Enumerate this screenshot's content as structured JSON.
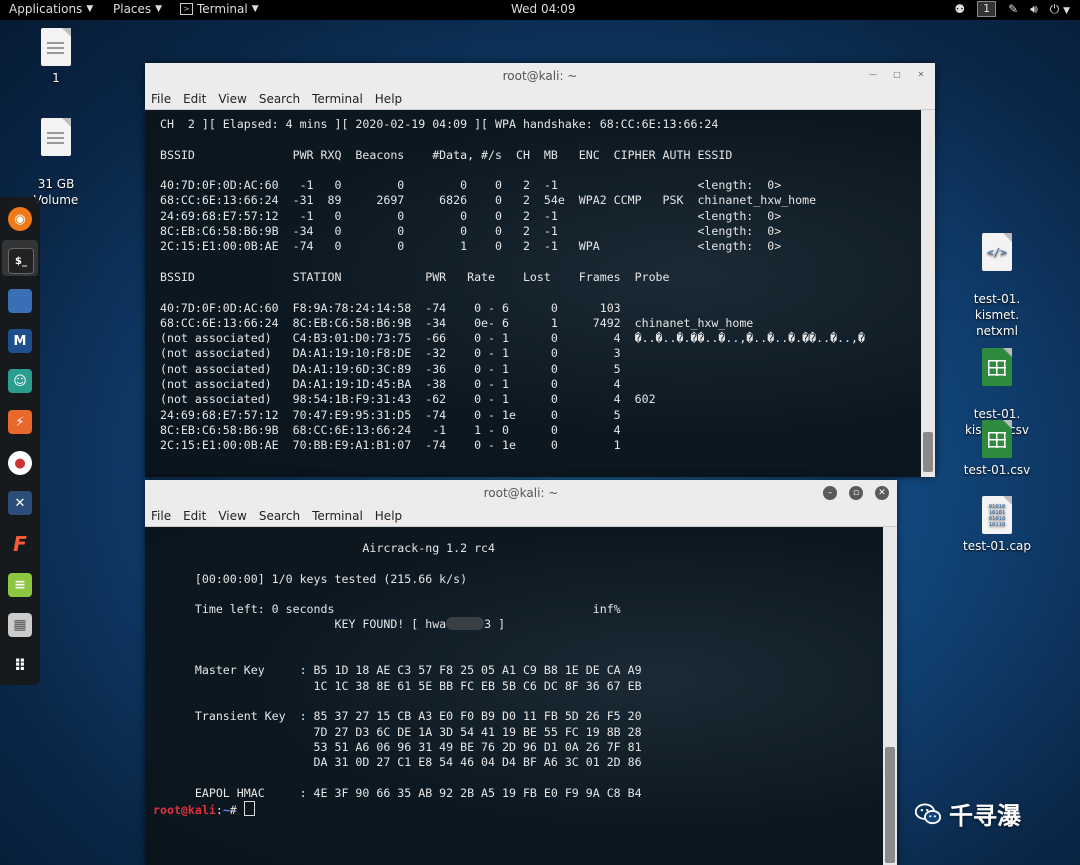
{
  "topbar": {
    "applications": "Applications",
    "places": "Places",
    "terminal": "Terminal",
    "clock": "Wed 04:09",
    "workspace": "1"
  },
  "desktop": {
    "icons": [
      {
        "label": "1",
        "type": "document"
      },
      {
        "label": "31 GB\nVolume",
        "type": "drive"
      },
      {
        "label": "test-01.\nkismet.\nnetxml",
        "type": "xml"
      },
      {
        "label": "test-01.\nkismet.csv",
        "type": "spreadsheet"
      },
      {
        "label": "test-01.csv",
        "type": "spreadsheet"
      },
      {
        "label": "test-01.cap",
        "type": "binary"
      }
    ]
  },
  "dock": {
    "items": [
      "firefox-icon",
      "terminal-icon",
      "files-icon",
      "metasploit-icon",
      "armitage-icon",
      "burpsuite-icon",
      "maltego-icon",
      "beef-icon",
      "faraday-icon",
      "leafpad-icon",
      "cutycapt-icon",
      "show-apps-icon"
    ]
  },
  "window1": {
    "title": "root@kali: ~",
    "menu": [
      "File",
      "Edit",
      "View",
      "Search",
      "Terminal",
      "Help"
    ],
    "lines": [
      " CH  2 ][ Elapsed: 4 mins ][ 2020-02-19 04:09 ][ WPA handshake: 68:CC:6E:13:66:24",
      "",
      " BSSID              PWR RXQ  Beacons    #Data, #/s  CH  MB   ENC  CIPHER AUTH ESSID",
      "",
      " 40:7D:0F:0D:AC:60   -1   0        0        0    0   2  -1                    <length:  0>",
      " 68:CC:6E:13:66:24  -31  89     2697     6826    0   2  54e  WPA2 CCMP   PSK  chinanet_hxw_home",
      " 24:69:68:E7:57:12   -1   0        0        0    0   2  -1                    <length:  0>",
      " 8C:EB:C6:58:B6:9B  -34   0        0        0    0   2  -1                    <length:  0>",
      " 2C:15:E1:00:0B:AE  -74   0        0        1    0   2  -1   WPA              <length:  0>",
      "",
      " BSSID              STATION            PWR   Rate    Lost    Frames  Probe",
      "",
      " 40:7D:0F:0D:AC:60  F8:9A:78:24:14:58  -74    0 - 6      0      103",
      " 68:CC:6E:13:66:24  8C:EB:C6:58:B6:9B  -34    0e- 6      1     7492  chinanet_hxw_home",
      " (not associated)   C4:B3:01:D0:73:75  -66    0 - 1      0        4  �..�..�.��..�..,�..�..�.��..�..,�",
      " (not associated)   DA:A1:19:10:F8:DE  -32    0 - 1      0        3",
      " (not associated)   DA:A1:19:6D:3C:89  -36    0 - 1      0        5",
      " (not associated)   DA:A1:19:1D:45:BA  -38    0 - 1      0        4",
      " (not associated)   98:54:1B:F9:31:43  -62    0 - 1      0        4  602",
      " 24:69:68:E7:57:12  70:47:E9:95:31:D5  -74    0 - 1e     0        5",
      " 8C:EB:C6:58:B6:9B  68:CC:6E:13:66:24   -1    1 - 0      0        4",
      " 2C:15:E1:00:0B:AE  70:BB:E9:A1:B1:07  -74    0 - 1e     0        1"
    ]
  },
  "window2": {
    "title": "root@kali: ~",
    "menu": [
      "File",
      "Edit",
      "View",
      "Search",
      "Terminal",
      "Help"
    ],
    "lines_top": [
      "                              Aircrack-ng 1.2 rc4",
      "",
      "      [00:00:00] 1/0 keys tested (215.66 k/s)",
      "",
      "      Time left: 0 seconds                                     inf%"
    ],
    "key_prefix": "                          KEY FOUND! [ hwa",
    "key_suffix": "3 ]",
    "lines_bottom": [
      "",
      "",
      "      Master Key     : B5 1D 18 AE C3 57 F8 25 05 A1 C9 B8 1E DE CA A9",
      "                       1C 1C 38 8E 61 5E BB FC EB 5B C6 DC 8F 36 67 EB",
      "",
      "      Transient Key  : 85 37 27 15 CB A3 E0 F0 B9 D0 11 FB 5D 26 F5 20",
      "                       7D 27 D3 6C DE 1A 3D 54 41 19 BE 55 FC 19 8B 28",
      "                       53 51 A6 06 96 31 49 BE 76 2D 96 D1 0A 26 7F 81",
      "                       DA 31 0D 27 C1 E8 54 46 04 D4 BF A6 3C 01 2D 86",
      "",
      "      EAPOL HMAC     : 4E 3F 90 66 35 AB 92 2B A5 19 FB E0 F9 9A C8 B4"
    ],
    "prompt_user": "root@kali",
    "prompt_sep": ":",
    "prompt_path": "~",
    "prompt_sym": "# "
  },
  "watermark": "千寻瀑",
  "colors": {
    "prompt_user": "#e0303a",
    "prompt_path": "#4f8fe6",
    "terminal_bg": "#0c1821"
  }
}
